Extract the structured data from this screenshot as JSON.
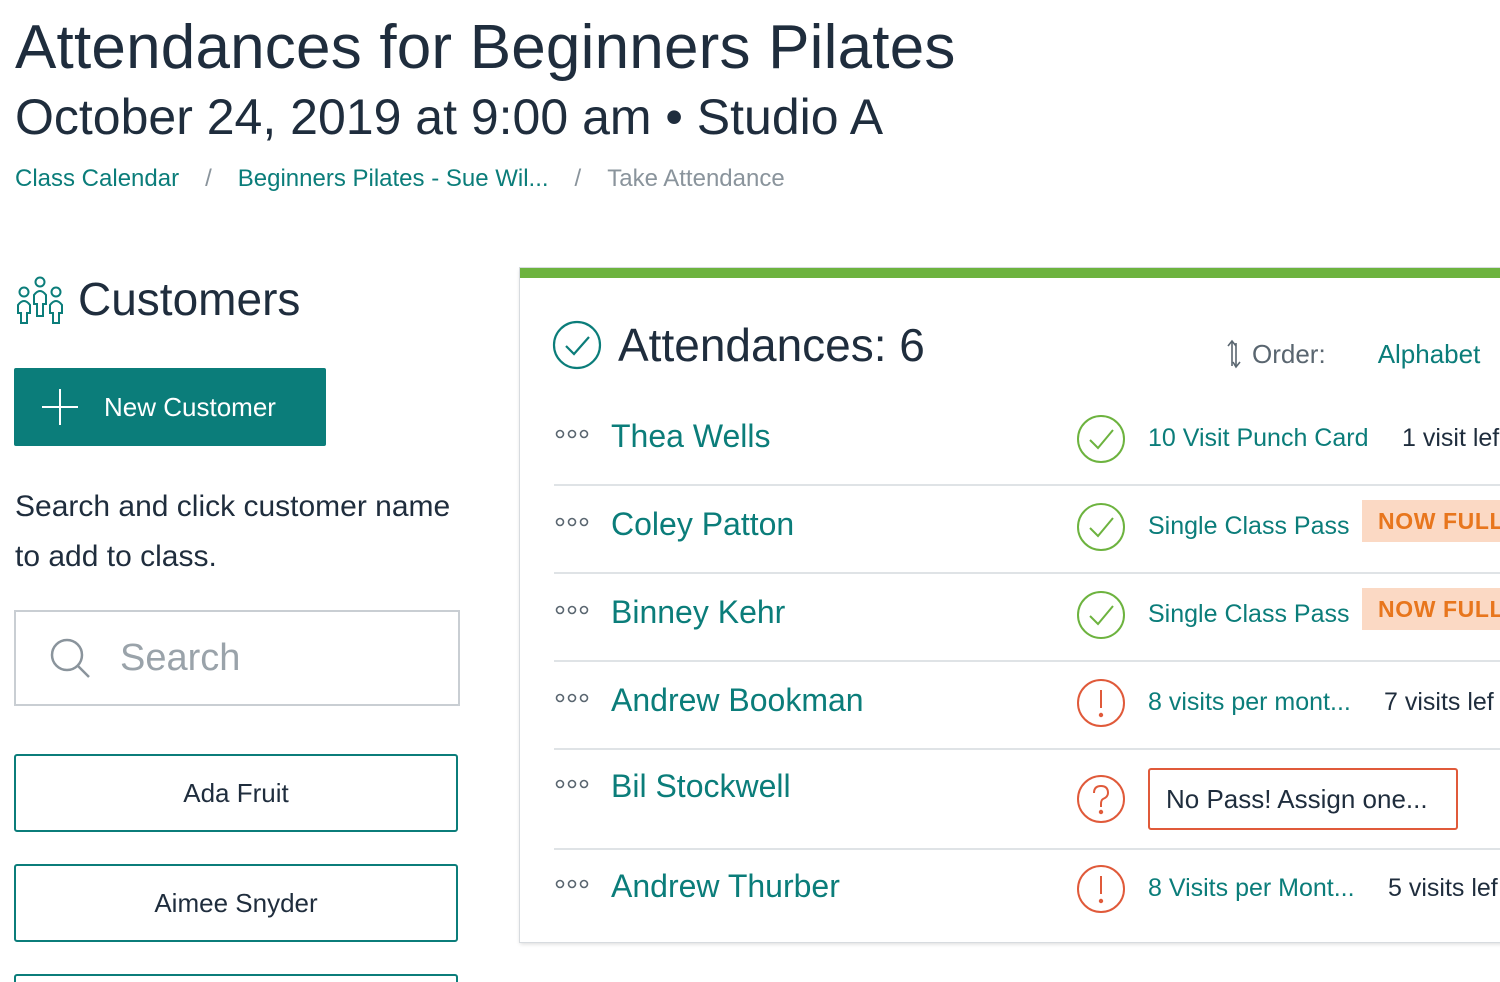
{
  "header": {
    "title": "Attendances for Beginners Pilates",
    "subtitle": "October 24, 2019 at 9:00 am • Studio A"
  },
  "breadcrumb": {
    "items": [
      "Class Calendar",
      "Beginners Pilates - Sue Wil...",
      "Take Attendance"
    ],
    "separator": "/"
  },
  "customers": {
    "heading": "Customers",
    "new_button_label": "New Customer",
    "help_text": "Search and click customer name to add to class.",
    "search_placeholder": "Search",
    "list": [
      "Ada Fruit",
      "Aimee Snyder"
    ]
  },
  "attendances": {
    "heading": "Attendances: 6",
    "order_label": "Order:",
    "order_value": "Alphabet",
    "rows": [
      {
        "name": "Thea Wells",
        "status": "checked",
        "pass": "10 Visit Punch Card",
        "remaining": "1 visit lef"
      },
      {
        "name": "Coley Patton",
        "status": "checked",
        "pass": "Single Class Pass",
        "badge": "NOW FULL"
      },
      {
        "name": "Binney Kehr",
        "status": "checked",
        "pass": "Single Class Pass",
        "badge": "NOW FULL"
      },
      {
        "name": "Andrew Bookman",
        "status": "warning",
        "pass": "8 visits per mont...",
        "remaining": "7 visits lef"
      },
      {
        "name": "Bil Stockwell",
        "status": "unknown",
        "assign_label": "No Pass! Assign one..."
      },
      {
        "name": "Andrew Thurber",
        "status": "warning",
        "pass": "8 Visits per Mont...",
        "remaining": "5 visits lef"
      }
    ]
  },
  "colors": {
    "brand_teal": "#0b7d7a",
    "success_green": "#6db33f",
    "warning_red": "#e05a3a",
    "badge_bg": "#fbd9c4",
    "badge_text": "#e8761d"
  }
}
